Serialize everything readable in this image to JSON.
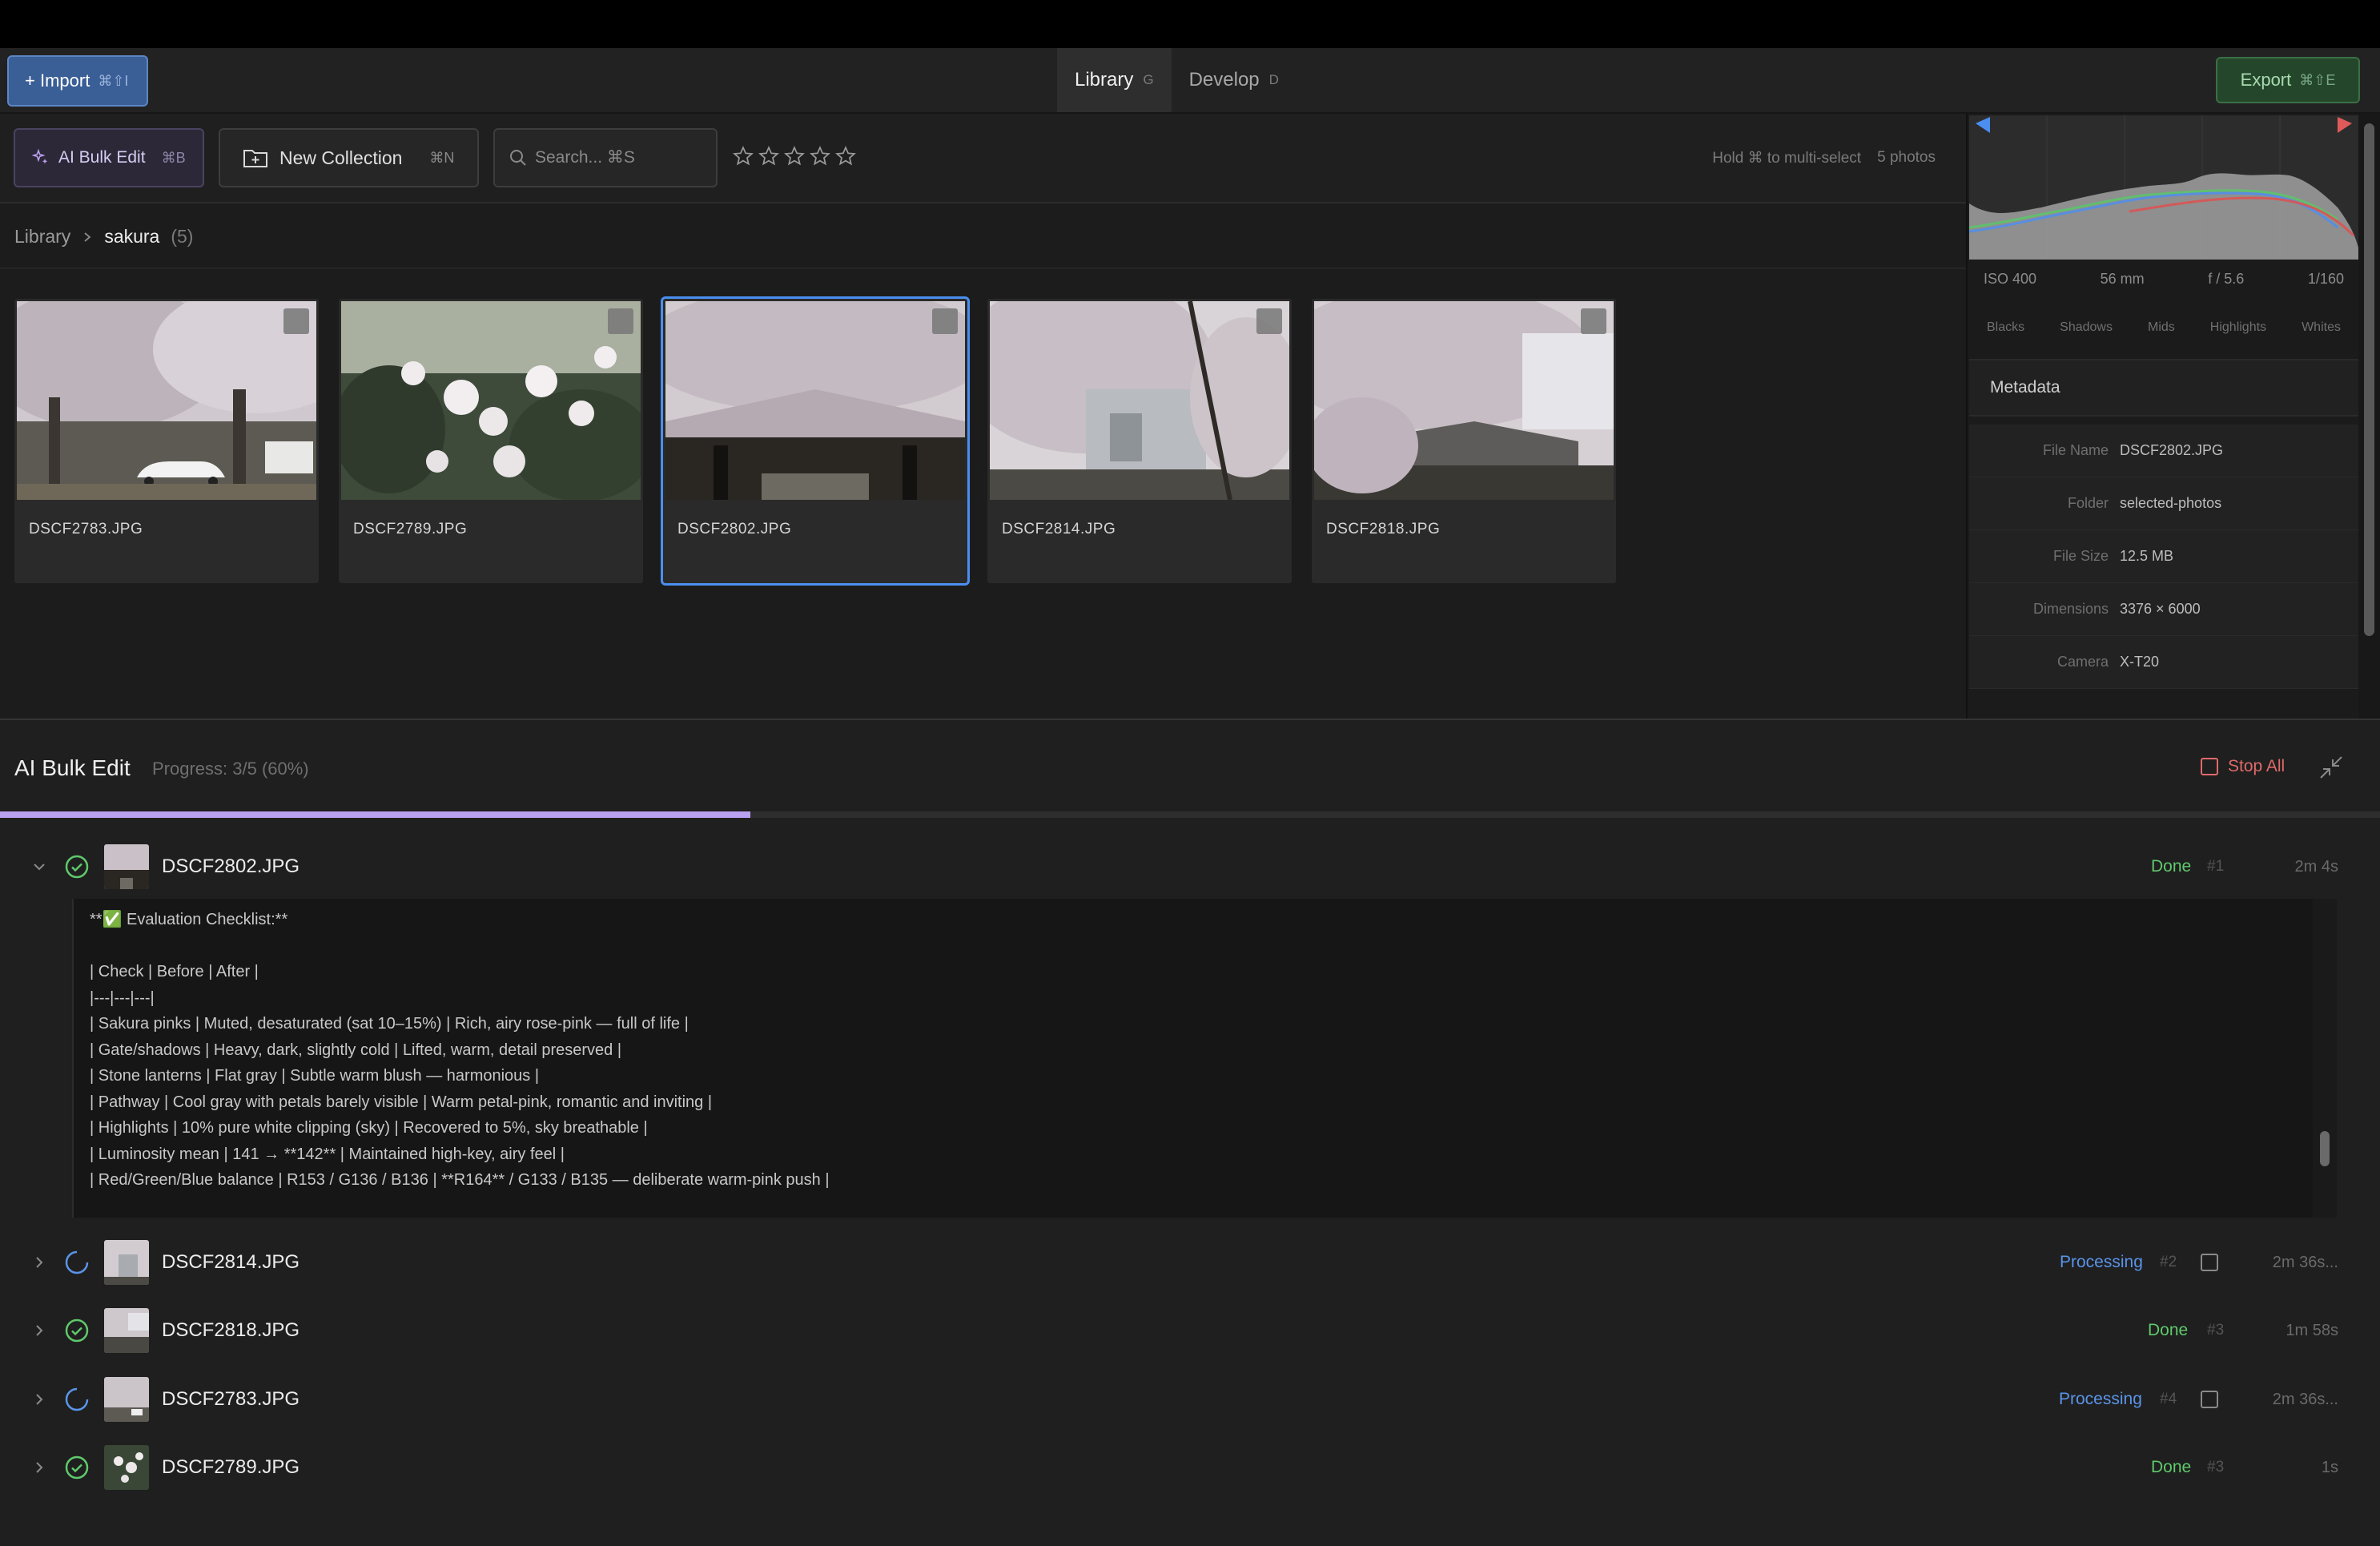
{
  "toolbar": {
    "import_label": "+ Import",
    "import_kbd": "⌘⇧I",
    "tabs": [
      {
        "label": "Library",
        "kbd": "G"
      },
      {
        "label": "Develop",
        "kbd": "D"
      }
    ],
    "export_label": "Export",
    "export_kbd": "⌘⇧E"
  },
  "library_toolbar": {
    "ai_bulk_label": "AI Bulk Edit",
    "ai_bulk_kbd": "⌘B",
    "new_collection_label": "New Collection",
    "new_collection_kbd": "⌘N",
    "search_placeholder": "Search... ⌘S",
    "rating_stars": 0,
    "hint": "Hold ⌘ to multi-select",
    "count": "5 photos"
  },
  "breadcrumb": {
    "root": "Library",
    "current": "sakura",
    "count": "(5)"
  },
  "photos": [
    {
      "name": "DSCF2783.JPG",
      "selected": false
    },
    {
      "name": "DSCF2789.JPG",
      "selected": false
    },
    {
      "name": "DSCF2802.JPG",
      "selected": true
    },
    {
      "name": "DSCF2814.JPG",
      "selected": false
    },
    {
      "name": "DSCF2818.JPG",
      "selected": false
    }
  ],
  "develop": {
    "exif": {
      "iso": "ISO 400",
      "focal": "56 mm",
      "aperture": "f / 5.6",
      "shutter": "1/160"
    },
    "zones": [
      "Blacks",
      "Shadows",
      "Mids",
      "Highlights",
      "Whites"
    ]
  },
  "metadata": {
    "title": "Metadata",
    "rows": [
      {
        "key": "File Name",
        "value": "DSCF2802.JPG"
      },
      {
        "key": "Folder",
        "value": "selected-photos"
      },
      {
        "key": "File Size",
        "value": "12.5 MB"
      },
      {
        "key": "Dimensions",
        "value": "3376 × 6000"
      },
      {
        "key": "Camera",
        "value": "X-T20"
      }
    ]
  },
  "bulk": {
    "title": "AI Bulk Edit",
    "progress_text": "Progress: 3/5 (60%)",
    "progress": 0.6,
    "stop_label": "Stop All",
    "jobs": [
      {
        "name": "DSCF2802.JPG",
        "status": "Done",
        "num": "#1",
        "time": "2m 4s",
        "expanded": true
      },
      {
        "name": "DSCF2814.JPG",
        "status": "Processing",
        "num": "#2",
        "time": "2m 36s..."
      },
      {
        "name": "DSCF2818.JPG",
        "status": "Done",
        "num": "#3",
        "time": "1m 58s"
      },
      {
        "name": "DSCF2783.JPG",
        "status": "Processing",
        "num": "#4",
        "time": "2m 36s..."
      },
      {
        "name": "DSCF2789.JPG",
        "status": "Done",
        "num": "#3",
        "time": "1s"
      }
    ],
    "log_lines": [
      "**✅ Evaluation Checklist:**",
      "",
      "| Check | Before | After |",
      "|---|---|---|",
      "| Sakura pinks | Muted, desaturated (sat 10–15%) | Rich, airy rose-pink — full of life |",
      "| Gate/shadows | Heavy, dark, slightly cold | Lifted, warm, detail preserved |",
      "| Stone lanterns | Flat gray | Subtle warm blush — harmonious |",
      "| Pathway | Cool gray with petals barely visible | Warm petal-pink, romantic and inviting |",
      "| Highlights | 10% pure white clipping (sky) | Recovered to 5%, sky breathable |",
      "| Luminosity mean | 141 → **142** | Maintained high-key, airy feel |",
      "| Red/Green/Blue balance | R153 / G136 / B136 | **R164** / G133 / B135 — deliberate warm-pink push |"
    ]
  }
}
